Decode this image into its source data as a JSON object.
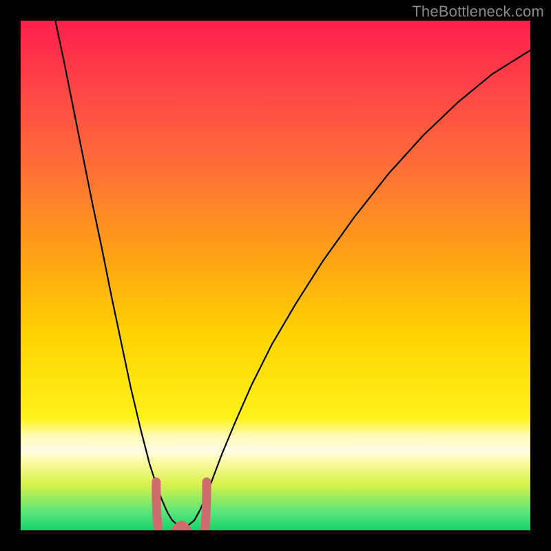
{
  "watermark": "TheBottleneck.com",
  "colors": {
    "frame": "#000000",
    "curve": "#000000",
    "bottom_marker": "#cf6a6e",
    "gradient_stops": [
      {
        "offset": 0.0,
        "color": "#ff1f4b"
      },
      {
        "offset": 0.14,
        "color": "#ff4747"
      },
      {
        "offset": 0.3,
        "color": "#ff7236"
      },
      {
        "offset": 0.47,
        "color": "#ffa514"
      },
      {
        "offset": 0.62,
        "color": "#ffd400"
      },
      {
        "offset": 0.78,
        "color": "#fff21a"
      },
      {
        "offset": 0.815,
        "color": "#fffbb7"
      },
      {
        "offset": 0.845,
        "color": "#fffde8"
      },
      {
        "offset": 0.86,
        "color": "#fffbb1"
      },
      {
        "offset": 0.91,
        "color": "#d8f24a"
      },
      {
        "offset": 0.965,
        "color": "#57e57a"
      },
      {
        "offset": 1.0,
        "color": "#17d36a"
      }
    ]
  },
  "chart_data": {
    "type": "line",
    "title": "",
    "xlabel": "",
    "ylabel": "",
    "xlim": [
      0,
      100
    ],
    "ylim": [
      0,
      100
    ],
    "note": "Curve defined by normalized (x,y) points within the 740x740 plot area; y=0 at top. Lower values near the dip imply better (green zone).",
    "series": [
      {
        "name": "bottleneck-curve",
        "points_xy_norm": [
          [
            0.068,
            0.0
          ],
          [
            0.085,
            0.08
          ],
          [
            0.104,
            0.175
          ],
          [
            0.122,
            0.265
          ],
          [
            0.141,
            0.36
          ],
          [
            0.16,
            0.45
          ],
          [
            0.178,
            0.54
          ],
          [
            0.197,
            0.63
          ],
          [
            0.216,
            0.72
          ],
          [
            0.235,
            0.8
          ],
          [
            0.253,
            0.87
          ],
          [
            0.266,
            0.91
          ],
          [
            0.277,
            0.94
          ],
          [
            0.288,
            0.965
          ],
          [
            0.297,
            0.98
          ],
          [
            0.308,
            0.99
          ],
          [
            0.318,
            0.993
          ],
          [
            0.329,
            0.99
          ],
          [
            0.341,
            0.98
          ],
          [
            0.352,
            0.96
          ],
          [
            0.365,
            0.93
          ],
          [
            0.378,
            0.895
          ],
          [
            0.395,
            0.85
          ],
          [
            0.42,
            0.79
          ],
          [
            0.453,
            0.715
          ],
          [
            0.493,
            0.635
          ],
          [
            0.54,
            0.555
          ],
          [
            0.594,
            0.47
          ],
          [
            0.655,
            0.385
          ],
          [
            0.722,
            0.3
          ],
          [
            0.79,
            0.225
          ],
          [
            0.858,
            0.16
          ],
          [
            0.925,
            0.105
          ],
          [
            1.0,
            0.058
          ]
        ]
      }
    ],
    "marker": {
      "name": "dip-marker",
      "color": "#cf6a6e",
      "x_range_norm": [
        0.266,
        0.365
      ],
      "y_norm": 0.99,
      "shape": "U"
    }
  }
}
